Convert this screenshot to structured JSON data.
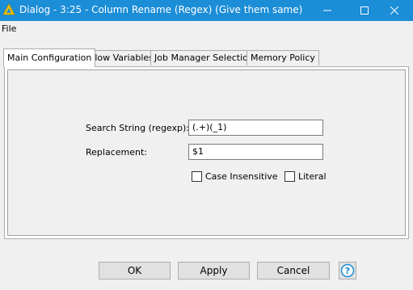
{
  "window": {
    "title": "Dialog - 3:25 - Column Rename (Regex) (Give them same)",
    "colors": {
      "titlebar": "#1c8dd7",
      "app_icon": "#f5c400"
    }
  },
  "menu": {
    "file": "File"
  },
  "tabs": [
    {
      "label": "Main Configuration",
      "active": true
    },
    {
      "label": "Flow Variables",
      "active": false
    },
    {
      "label": "Job Manager Selection",
      "active": false
    },
    {
      "label": "Memory Policy",
      "active": false
    }
  ],
  "form": {
    "search_label": "Search String (regexp):",
    "search_value": "(.+)(_1)",
    "replacement_label": "Replacement:",
    "replacement_value": "$1",
    "case_insensitive_label": "Case Insensitive",
    "case_insensitive_checked": false,
    "literal_label": "Literal",
    "literal_checked": false
  },
  "buttons": {
    "ok": "OK",
    "apply": "Apply",
    "cancel": "Cancel",
    "help": "?"
  }
}
